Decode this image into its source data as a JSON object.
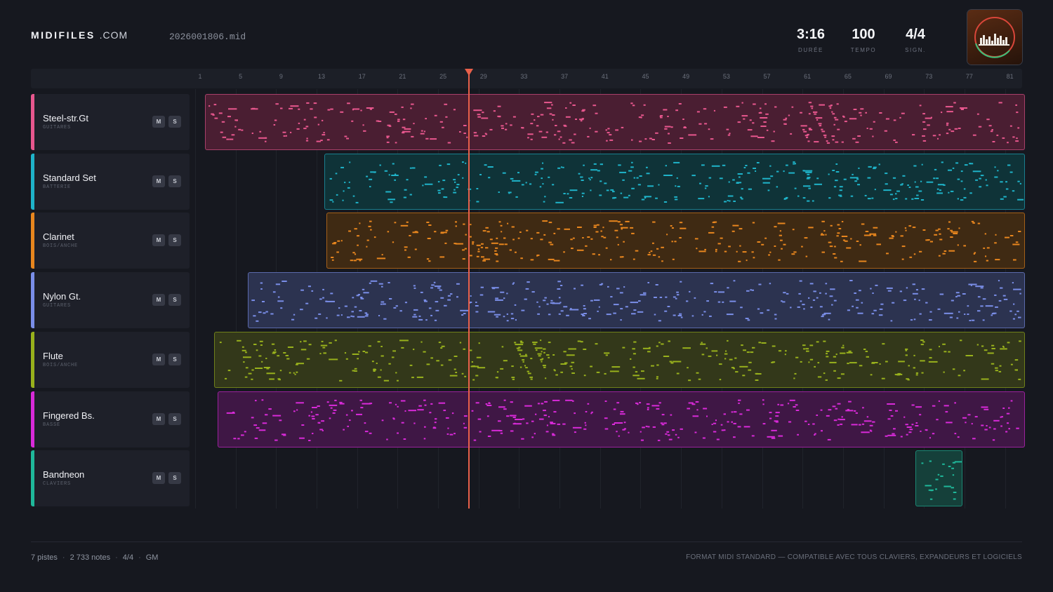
{
  "header": {
    "logo_bold": "MIDIFILES",
    "logo_light": ".COM",
    "filename": "2026001806.mid",
    "stats": [
      {
        "value": "3:16",
        "label": "DURÉE"
      },
      {
        "value": "100",
        "label": "TEMPO"
      },
      {
        "value": "4/4",
        "label": "SIGN."
      }
    ]
  },
  "ruler": {
    "bar_labels": [
      "1",
      "5",
      "9",
      "13",
      "17",
      "21",
      "25",
      "29",
      "33",
      "37",
      "41",
      "45",
      "49",
      "53",
      "57",
      "61",
      "65",
      "69",
      "73",
      "77",
      "81"
    ]
  },
  "playhead_bar": 27.5,
  "tracks": [
    {
      "name": "Steel-str.Gt",
      "category": "GUITARES",
      "color": "#e8578e",
      "clip_bg": "#4a1e32",
      "mute": "M",
      "solo": "S",
      "clips": [
        [
          1.5,
          82.5
        ]
      ]
    },
    {
      "name": "Standard Set",
      "category": "BATTERIE",
      "color": "#1fb3c9",
      "clip_bg": "#0f3338",
      "mute": "M",
      "solo": "S",
      "clips": [
        [
          13.3,
          82.5
        ]
      ]
    },
    {
      "name": "Clarinet",
      "category": "BOIS/ANCHE",
      "color": "#e8861e",
      "clip_bg": "#3f2a13",
      "mute": "M",
      "solo": "S",
      "clips": [
        [
          13.5,
          82.5
        ]
      ]
    },
    {
      "name": "Nylon Gt.",
      "category": "GUITARES",
      "color": "#7a8ee8",
      "clip_bg": "#2c3350",
      "mute": "M",
      "solo": "S",
      "clips": [
        [
          5.7,
          82.5
        ]
      ]
    },
    {
      "name": "Flute",
      "category": "BOIS/ANCHE",
      "color": "#98b11c",
      "clip_bg": "#33381a",
      "mute": "M",
      "solo": "S",
      "clips": [
        [
          2.4,
          82.5
        ]
      ]
    },
    {
      "name": "Fingered Bs.",
      "category": "BASSE",
      "color": "#d92ad9",
      "clip_bg": "#3f1745",
      "mute": "M",
      "solo": "S",
      "clips": [
        [
          2.7,
          82.5
        ]
      ]
    },
    {
      "name": "Bandneon",
      "category": "CLAVIERS",
      "color": "#1fb89a",
      "clip_bg": "#15403a",
      "mute": "M",
      "solo": "S",
      "clips": [
        [
          71.7,
          76.3
        ]
      ]
    }
  ],
  "footer": {
    "tracks": "7 pistes",
    "notes": "2 733 notes",
    "sig": "4/4",
    "std": "GM",
    "right": "FORMAT MIDI STANDARD — COMPATIBLE AVEC TOUS CLAVIERS, EXPANDEURS ET LOGICIELS"
  }
}
